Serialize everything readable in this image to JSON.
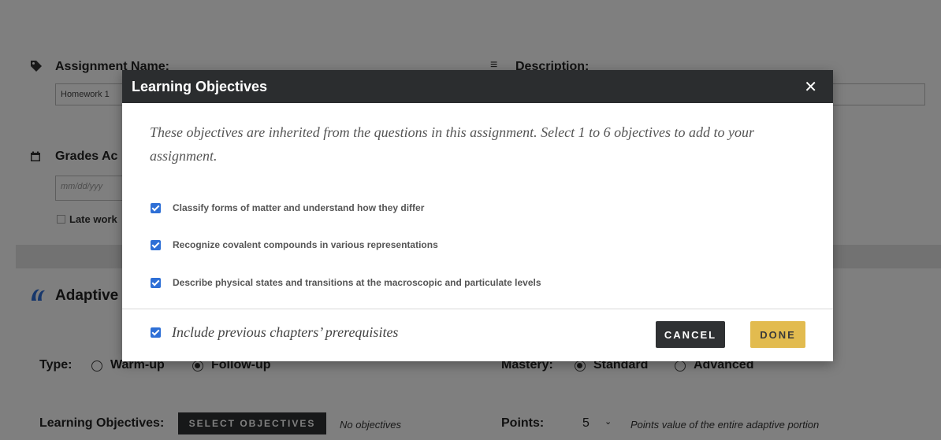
{
  "background": {
    "assignment_name_label": "Assignment Name:",
    "assignment_name_value": "Homework 1",
    "description_label": "Description:",
    "grades_label": "Grades Ac",
    "date_placeholder": "mm/dd/yyy",
    "late_work_label": "Late work",
    "adaptive_title": "Adaptive",
    "type_label": "Type:",
    "type_options": [
      "Warm-up",
      "Follow-up"
    ],
    "type_selected": "Follow-up",
    "mastery_label": "Mastery:",
    "mastery_options": [
      "Standard",
      "Advanced"
    ],
    "mastery_selected": "Standard",
    "learning_objectives_label": "Learning Objectives:",
    "select_objectives_label": "SELECT OBJECTIVES",
    "no_objectives_text": "No objectives",
    "points_label": "Points:",
    "points_value": "5",
    "points_note": "Points value of the entire adaptive portion"
  },
  "modal": {
    "title": "Learning Objectives",
    "close_glyph": "✕",
    "intro": "These objectives are inherited from the questions in this assignment. Select 1 to 6 objectives to add to your assignment.",
    "objectives": [
      {
        "label": "Classify forms of matter and understand how they differ",
        "checked": true
      },
      {
        "label": "Recognize covalent compounds in various representations",
        "checked": true
      },
      {
        "label": "Describe physical states and transitions at the macroscopic and particulate levels",
        "checked": true
      }
    ],
    "prereq_label": "Include previous chapters’ prerequisites",
    "prereq_checked": true,
    "cancel_label": "CANCEL",
    "done_label": "DONE"
  },
  "colors": {
    "header_bg": "#2b2d2f",
    "checkbox": "#2e6fd6",
    "done_button": "#e2bb4f",
    "cancel_button": "#2f3133"
  }
}
